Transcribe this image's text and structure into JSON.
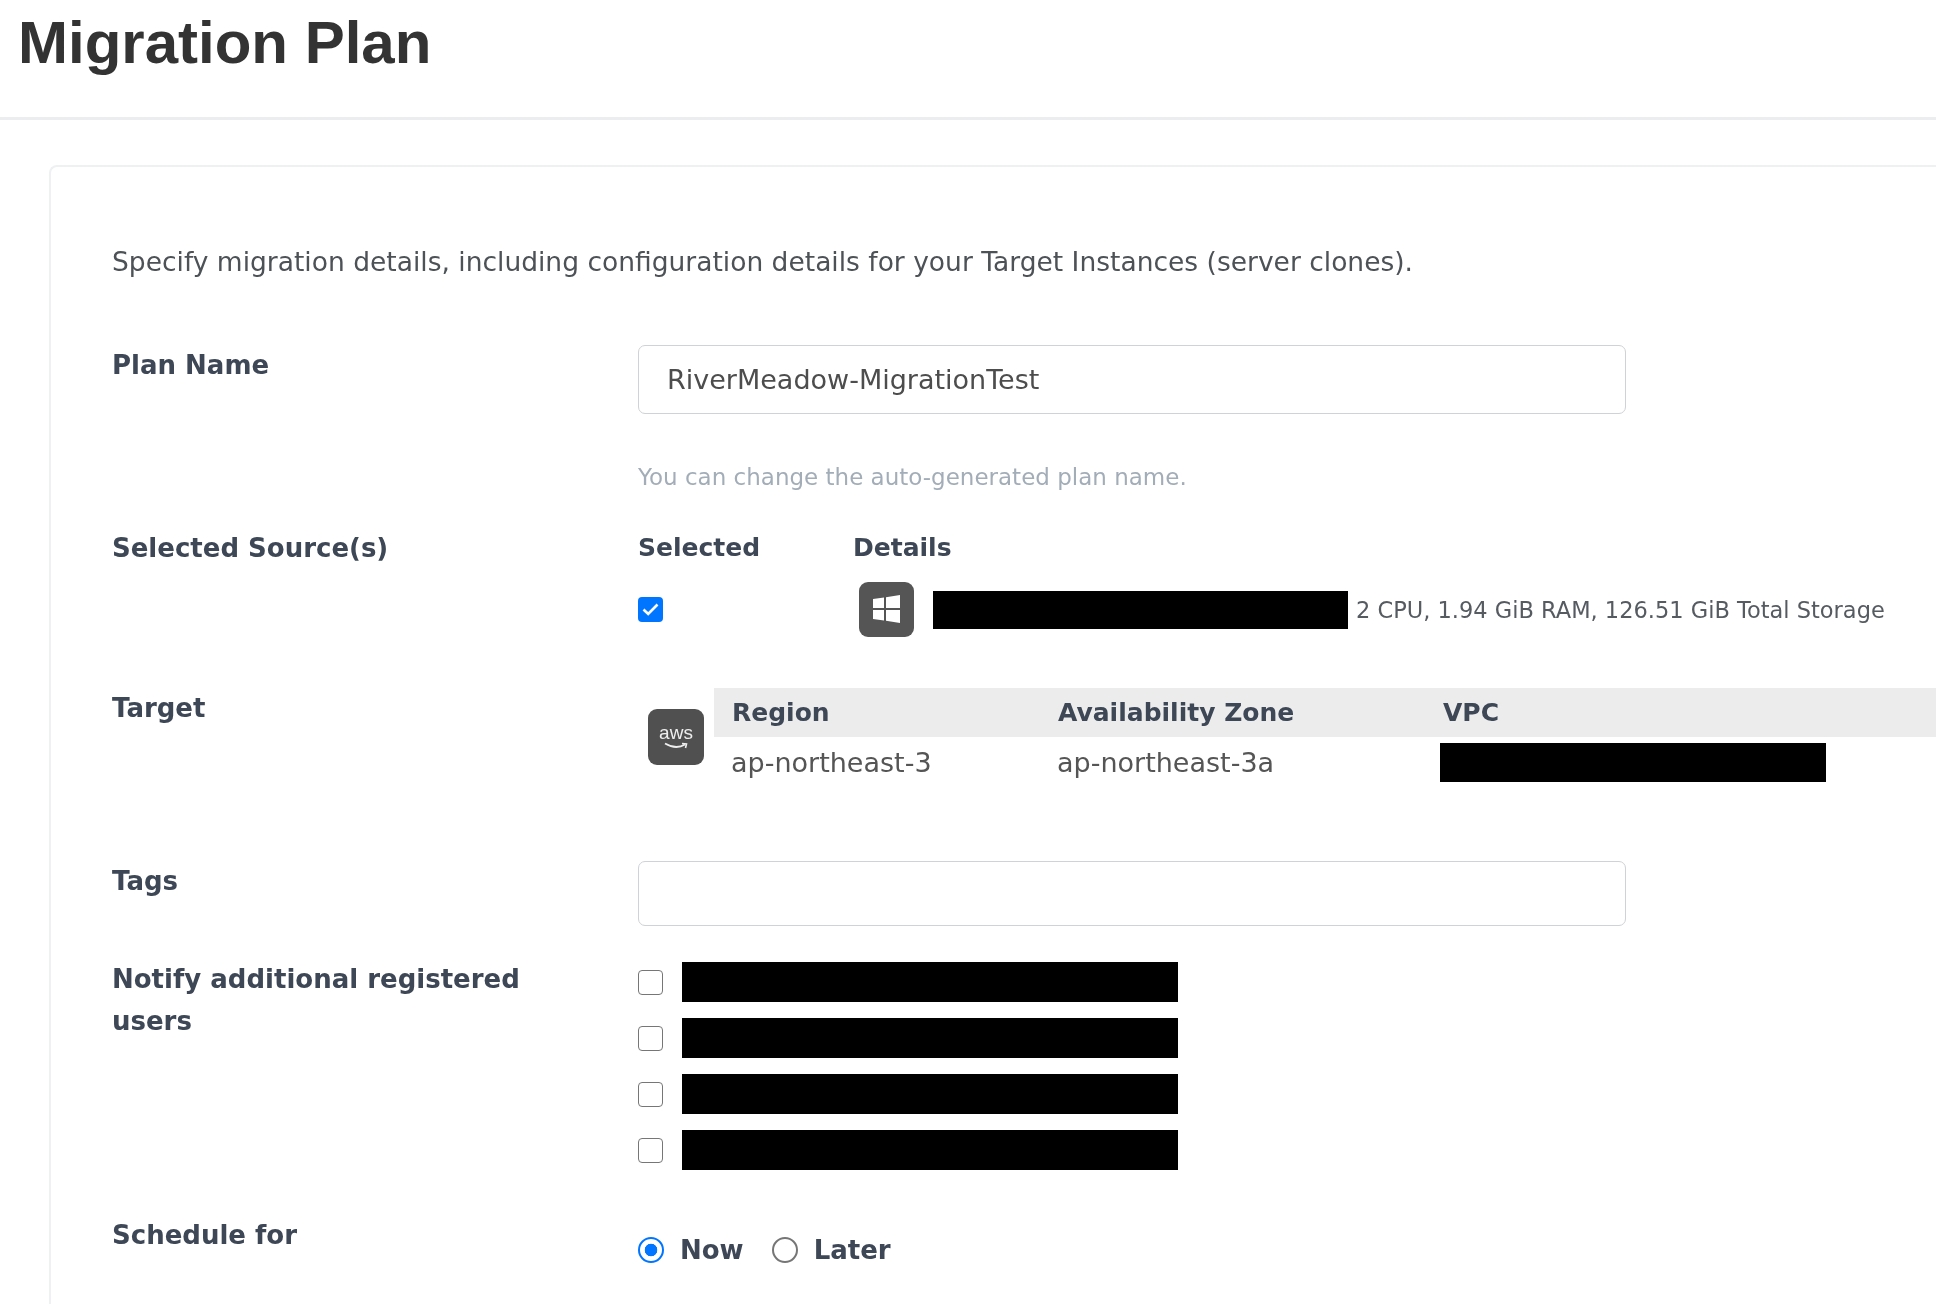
{
  "page": {
    "title": "Migration Plan"
  },
  "form": {
    "description": "Specify migration details, including configuration details for your Target Instances (server clones).",
    "plan_name": {
      "label": "Plan Name",
      "value": "RiverMeadow-MigrationTest",
      "hint": "You can change the auto-generated plan name."
    },
    "sources": {
      "label": "Selected Source(s)",
      "columns": [
        "Selected",
        "Details"
      ],
      "items": [
        {
          "checked": true,
          "name_redacted": true,
          "specs": "2 CPU, 1.94 GiB RAM, 126.51 GiB Total Storage"
        }
      ]
    },
    "target": {
      "label": "Target",
      "logo": "aws",
      "columns": [
        "Region",
        "Availability Zone",
        "VPC"
      ],
      "row": [
        {
          "kind": "text",
          "text": "ap-northeast-3"
        },
        {
          "kind": "text",
          "text": "ap-northeast-3a"
        },
        {
          "kind": "redacted"
        }
      ]
    },
    "tags": {
      "label": "Tags"
    },
    "notify": {
      "label": "Notify additional registered users",
      "users": [
        {
          "checked": false,
          "redacted": true
        },
        {
          "checked": false,
          "redacted": true
        },
        {
          "checked": false,
          "redacted": true
        },
        {
          "checked": false,
          "redacted": true
        }
      ]
    },
    "schedule": {
      "label": "Schedule for",
      "options": [
        {
          "label": "Now",
          "selected": true
        },
        {
          "label": "Later",
          "selected": false
        }
      ]
    }
  }
}
